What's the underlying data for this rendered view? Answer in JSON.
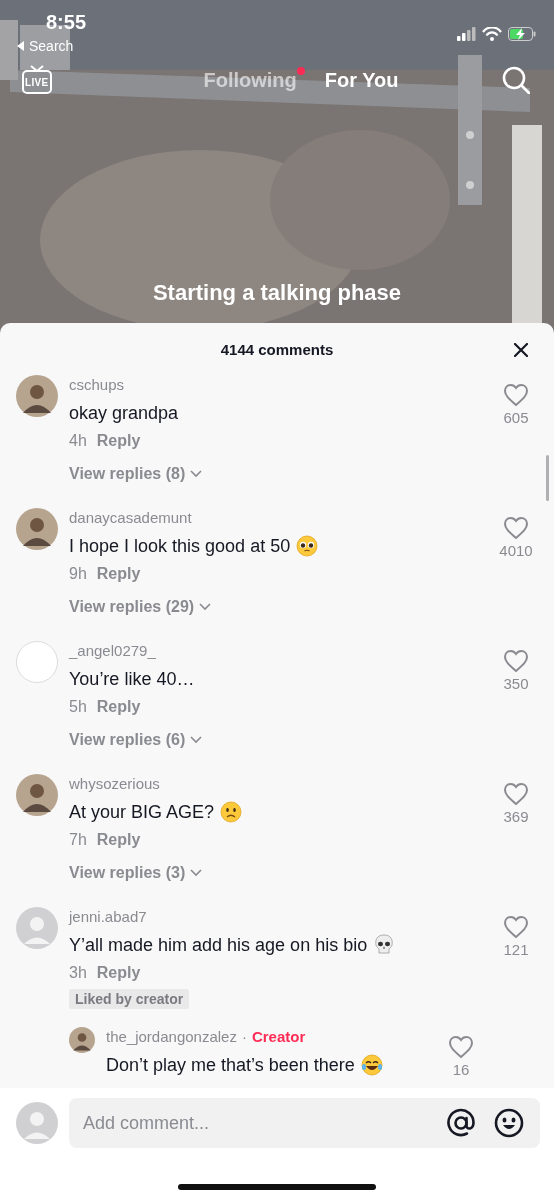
{
  "status_bar": {
    "time": "8:55",
    "back_label": "Search"
  },
  "top_nav": {
    "live_label": "LIVE",
    "tabs": [
      {
        "label": "Following",
        "selected": false,
        "badge": true
      },
      {
        "label": "For You",
        "selected": true,
        "badge": false
      }
    ]
  },
  "video": {
    "kind": "picture",
    "caption": "Starting a talking phase"
  },
  "comments_sheet": {
    "title": "4144 comments",
    "comments": [
      {
        "username": "cschups",
        "text": "okay grandpa",
        "time": "4h",
        "reply_label": "Reply",
        "likes": "605",
        "liked": false,
        "view_replies": "View replies (8)"
      },
      {
        "username": "danaycasademunt",
        "text": "I hope I look this good at 50",
        "emoji": {
          "kind": "pleading"
        },
        "time": "9h",
        "reply_label": "Reply",
        "likes": "4010",
        "liked": false,
        "view_replies": "View replies (29)"
      },
      {
        "username": "_angel0279_",
        "avatar": {
          "kind": "blank"
        },
        "text": "You’re like 40…",
        "time": "5h",
        "reply_label": "Reply",
        "likes": "350",
        "liked": false,
        "view_replies": "View replies (6)"
      },
      {
        "username": "whysozerious",
        "text": "At your BIG AGE?",
        "emoji": {
          "kind": "frowning"
        },
        "time": "7h",
        "reply_label": "Reply",
        "likes": "369",
        "liked": false,
        "view_replies": "View replies (3)"
      },
      {
        "username": "jenni.abad7",
        "avatar": {
          "kind": "default"
        },
        "text": "Y’all made him add his age on his bio",
        "emoji": {
          "kind": "skull"
        },
        "time": "3h",
        "reply_label": "Reply",
        "likes": "121",
        "liked": false,
        "liked_by_creator": "Liked by creator",
        "replies": [
          {
            "username": "the_jordangonzalez",
            "separator": "·",
            "badge": "Creator",
            "text": "Don’t play me that’s been there",
            "emoji": {
              "kind": "tears-of-joy"
            },
            "likes": "16",
            "liked": false
          }
        ]
      }
    ],
    "input": {
      "placeholder": "Add comment..."
    }
  }
}
